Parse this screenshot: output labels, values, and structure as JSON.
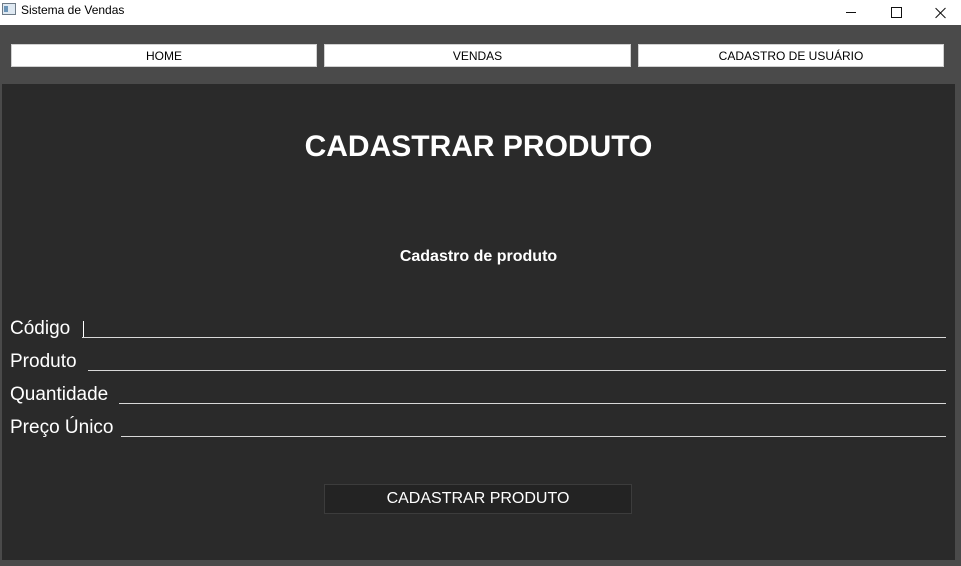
{
  "window": {
    "title": "Sistema de Vendas"
  },
  "nav": {
    "home": "HOME",
    "vendas": "VENDAS",
    "cadastro_usuario": "CADASTRO DE USUÁRIO"
  },
  "main": {
    "title": "CADASTRAR PRODUTO",
    "subtitle": "Cadastro de produto",
    "fields": [
      {
        "label": "Código",
        "value": ""
      },
      {
        "label": "Produto",
        "value": ""
      },
      {
        "label": "Quantidade",
        "value": ""
      },
      {
        "label": "Preço Único",
        "value": ""
      }
    ],
    "submit_label": "CADASTRAR PRODUTO"
  },
  "icons": {
    "app": "app-window-icon",
    "minimize": "minimize-icon",
    "maximize": "maximize-icon",
    "close": "close-icon"
  },
  "colors": {
    "panel_background": "#2a2a2a",
    "frame_background": "#4a4a4a",
    "text": "#ffffff"
  }
}
